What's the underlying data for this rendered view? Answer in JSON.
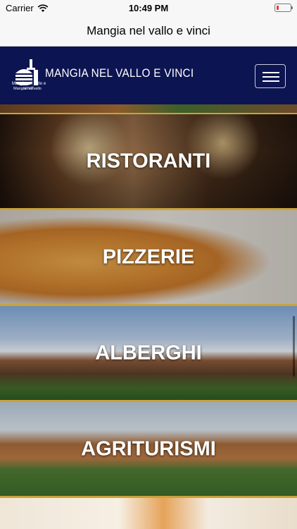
{
  "status": {
    "carrier": "Carrier",
    "time": "10:49 PM",
    "battery_color": "#e53935"
  },
  "nav": {
    "title": "Mangia nel vallo e vinci"
  },
  "header": {
    "site_name": "MANGIA NEL VALLO E VINCI",
    "logo_caption": "Mangia nel vallo e vinci!",
    "background": "#0c1451",
    "menu_icon": "hamburger-icon"
  },
  "categories": [
    {
      "label": "RISTORANTI"
    },
    {
      "label": "PIZZERIE"
    },
    {
      "label": "ALBERGHI"
    },
    {
      "label": "AGRITURISMI"
    }
  ],
  "accent": "#c9a23a"
}
